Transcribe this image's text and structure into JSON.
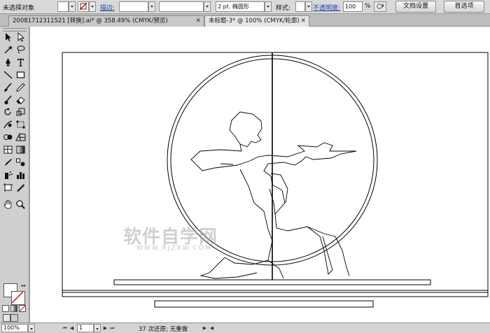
{
  "control_bar": {
    "selection_label": "未选择对象",
    "stroke_label": "描边:",
    "brush_label": "2 pt. 椭圆形",
    "style_label": "样式:",
    "opacity_label": "不透明度:",
    "opacity_value": "100",
    "opacity_unit": "%",
    "doc_setup_button": "文档设置",
    "preferences_button": "首选项"
  },
  "tabs": [
    {
      "label": "20081712311521 [转换].ai* @ 358.49% (CMYK/预览)"
    },
    {
      "label": "未标题-3* @ 100% (CMYK/轮廓)"
    }
  ],
  "tools": [
    "selection-tool-icon",
    "direct-selection-tool-icon",
    "magic-wand-tool-icon",
    "lasso-tool-icon",
    "pen-tool-icon",
    "type-tool-icon",
    "line-segment-tool-icon",
    "rectangle-tool-icon",
    "paintbrush-tool-icon",
    "pencil-tool-icon",
    "blob-brush-tool-icon",
    "eraser-tool-icon",
    "rotate-tool-icon",
    "scale-tool-icon",
    "warp-tool-icon",
    "free-transform-tool-icon",
    "shape-builder-tool-icon",
    "perspective-grid-tool-icon",
    "mesh-tool-icon",
    "gradient-tool-icon",
    "eyedropper-tool-icon",
    "blend-tool-icon",
    "symbol-sprayer-tool-icon",
    "column-graph-tool-icon",
    "artboard-tool-icon",
    "slice-tool-icon",
    "hand-tool-icon",
    "zoom-tool-icon"
  ],
  "status_bar": {
    "zoom": "100%",
    "artboard": "1",
    "message": "37 次还原; 无重做"
  },
  "watermark": {
    "text": "软件自学网",
    "url": "WWW.RJZXW.COM"
  }
}
